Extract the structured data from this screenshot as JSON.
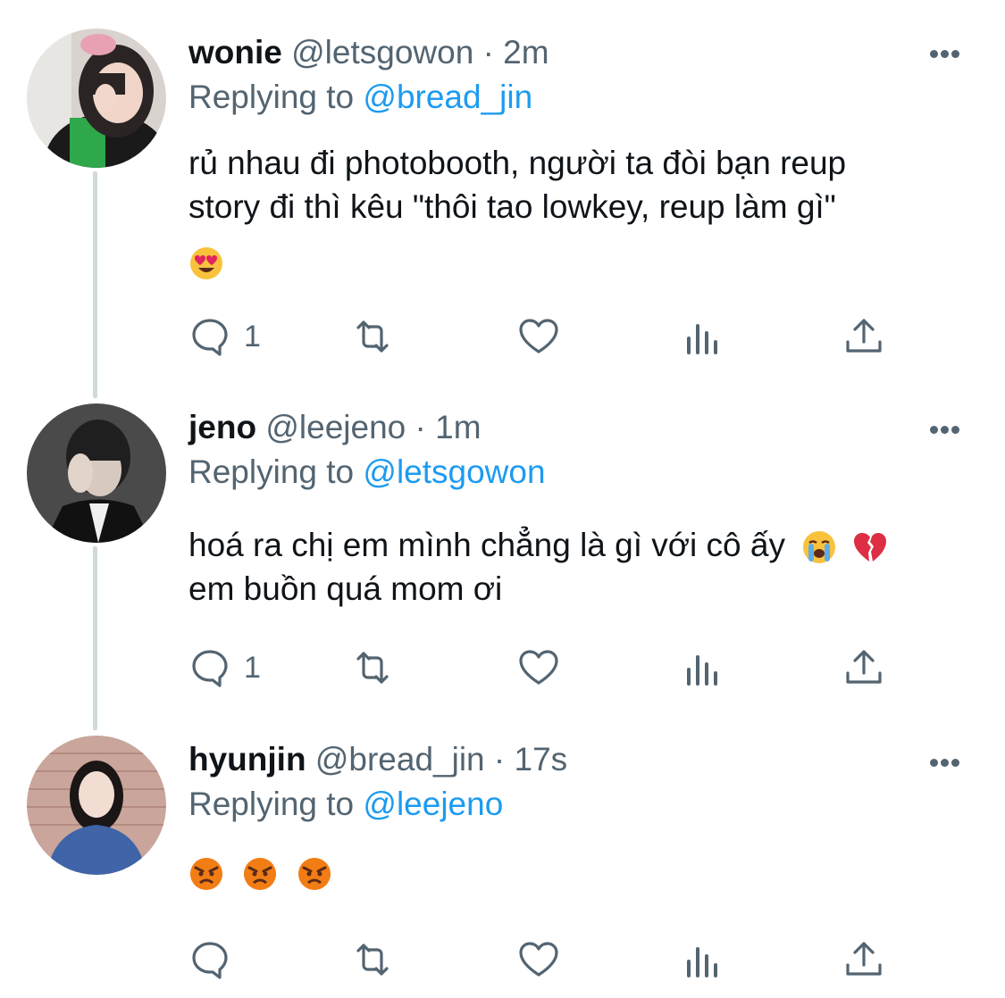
{
  "colors": {
    "accent": "#1d9bf0",
    "muted": "#536471",
    "text": "#0f1419",
    "thread_line": "#cfd9de"
  },
  "tweets": [
    {
      "display_name": "wonie",
      "handle": "@letsgowon",
      "time": "· 2m",
      "replying_prefix": "Replying to",
      "replying_to": "@bread_jin",
      "text_line1": "rủ nhau đi photobooth, người ta đòi bạn reup",
      "text_line2": "story đi thì kêu \"thôi tao lowkey, reup làm gì\"",
      "emojis": [
        "heart-eyes-emoji"
      ],
      "reply_count": "1"
    },
    {
      "display_name": "jeno",
      "handle": "@leejeno",
      "time": "· 1m",
      "replying_prefix": "Replying to",
      "replying_to": "@letsgowon",
      "text_line1": "hoá ra chị em mình chẳng là gì với cô ấy",
      "text_line2": "em buồn quá mom ơi",
      "emojis": [
        "crying-emoji",
        "broken-heart-emoji"
      ],
      "reply_count": "1"
    },
    {
      "display_name": "hyunjin",
      "handle": "@bread_jin",
      "time": "· 17s",
      "replying_prefix": "Replying to",
      "replying_to": "@leejeno",
      "emojis": [
        "angry-emoji",
        "angry-emoji",
        "angry-emoji"
      ],
      "reply_count": ""
    }
  ],
  "icons": [
    "reply-icon",
    "retweet-icon",
    "like-icon",
    "views-icon",
    "share-icon",
    "more-icon"
  ]
}
